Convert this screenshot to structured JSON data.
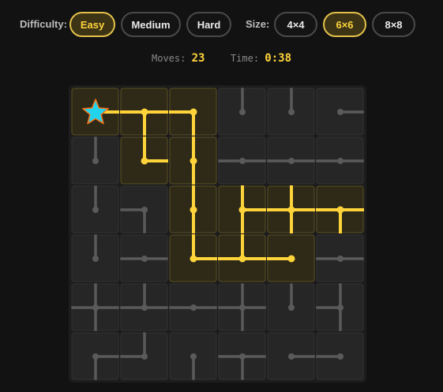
{
  "controls": {
    "difficulty_label": "Difficulty:",
    "difficulty": [
      "Easy",
      "Medium",
      "Hard"
    ],
    "difficulty_selected": "Easy",
    "size_label": "Size:",
    "sizes": [
      "4×4",
      "6×6",
      "8×8"
    ],
    "size_selected": "6×6"
  },
  "status": {
    "moves_label": "Moves:",
    "moves": "23",
    "time_label": "Time:",
    "time": "0:38"
  },
  "colors": {
    "accent": "#ffd43b",
    "pipe_off": "#5a5a5a",
    "tile_off": "#262626",
    "tile_on": "#2e2a17",
    "star_fill": "#22d3ee",
    "star_stroke": "#f97316"
  },
  "board": {
    "rows": 6,
    "cols": 6,
    "source": "star-icon",
    "tiles": [
      [
        {
          "c": "E",
          "on": true,
          "src": true
        },
        {
          "c": "WSE",
          "on": true
        },
        {
          "c": "WS",
          "on": true
        },
        {
          "c": "N",
          "on": false
        },
        {
          "c": "N",
          "on": false
        },
        {
          "c": "E",
          "on": false
        }
      ],
      [
        {
          "c": "N",
          "on": false
        },
        {
          "c": "NE",
          "on": true
        },
        {
          "c": "NS",
          "on": true
        },
        {
          "c": "WE",
          "on": false
        },
        {
          "c": "WE",
          "on": false
        },
        {
          "c": "WE",
          "on": false
        }
      ],
      [
        {
          "c": "N",
          "on": false
        },
        {
          "c": "WS",
          "on": false
        },
        {
          "c": "NS",
          "on": true
        },
        {
          "c": "NES",
          "on": true
        },
        {
          "c": "NEWS",
          "on": true
        },
        {
          "c": "WES",
          "on": true
        }
      ],
      [
        {
          "c": "N",
          "on": false
        },
        {
          "c": "WE",
          "on": false
        },
        {
          "c": "NE",
          "on": true
        },
        {
          "c": "WNE",
          "on": true
        },
        {
          "c": "W",
          "on": true
        },
        {
          "c": "WE",
          "on": false
        }
      ],
      [
        {
          "c": "WENS",
          "on": false
        },
        {
          "c": "WNE",
          "on": false
        },
        {
          "c": "WE",
          "on": false
        },
        {
          "c": "NEWS",
          "on": false
        },
        {
          "c": "N",
          "on": false
        },
        {
          "c": "NSW",
          "on": false
        }
      ],
      [
        {
          "c": "ES",
          "on": false
        },
        {
          "c": "NW",
          "on": false
        },
        {
          "c": "S",
          "on": false
        },
        {
          "c": "WES",
          "on": false
        },
        {
          "c": "E",
          "on": false
        },
        {
          "c": "W",
          "on": false
        }
      ]
    ]
  }
}
